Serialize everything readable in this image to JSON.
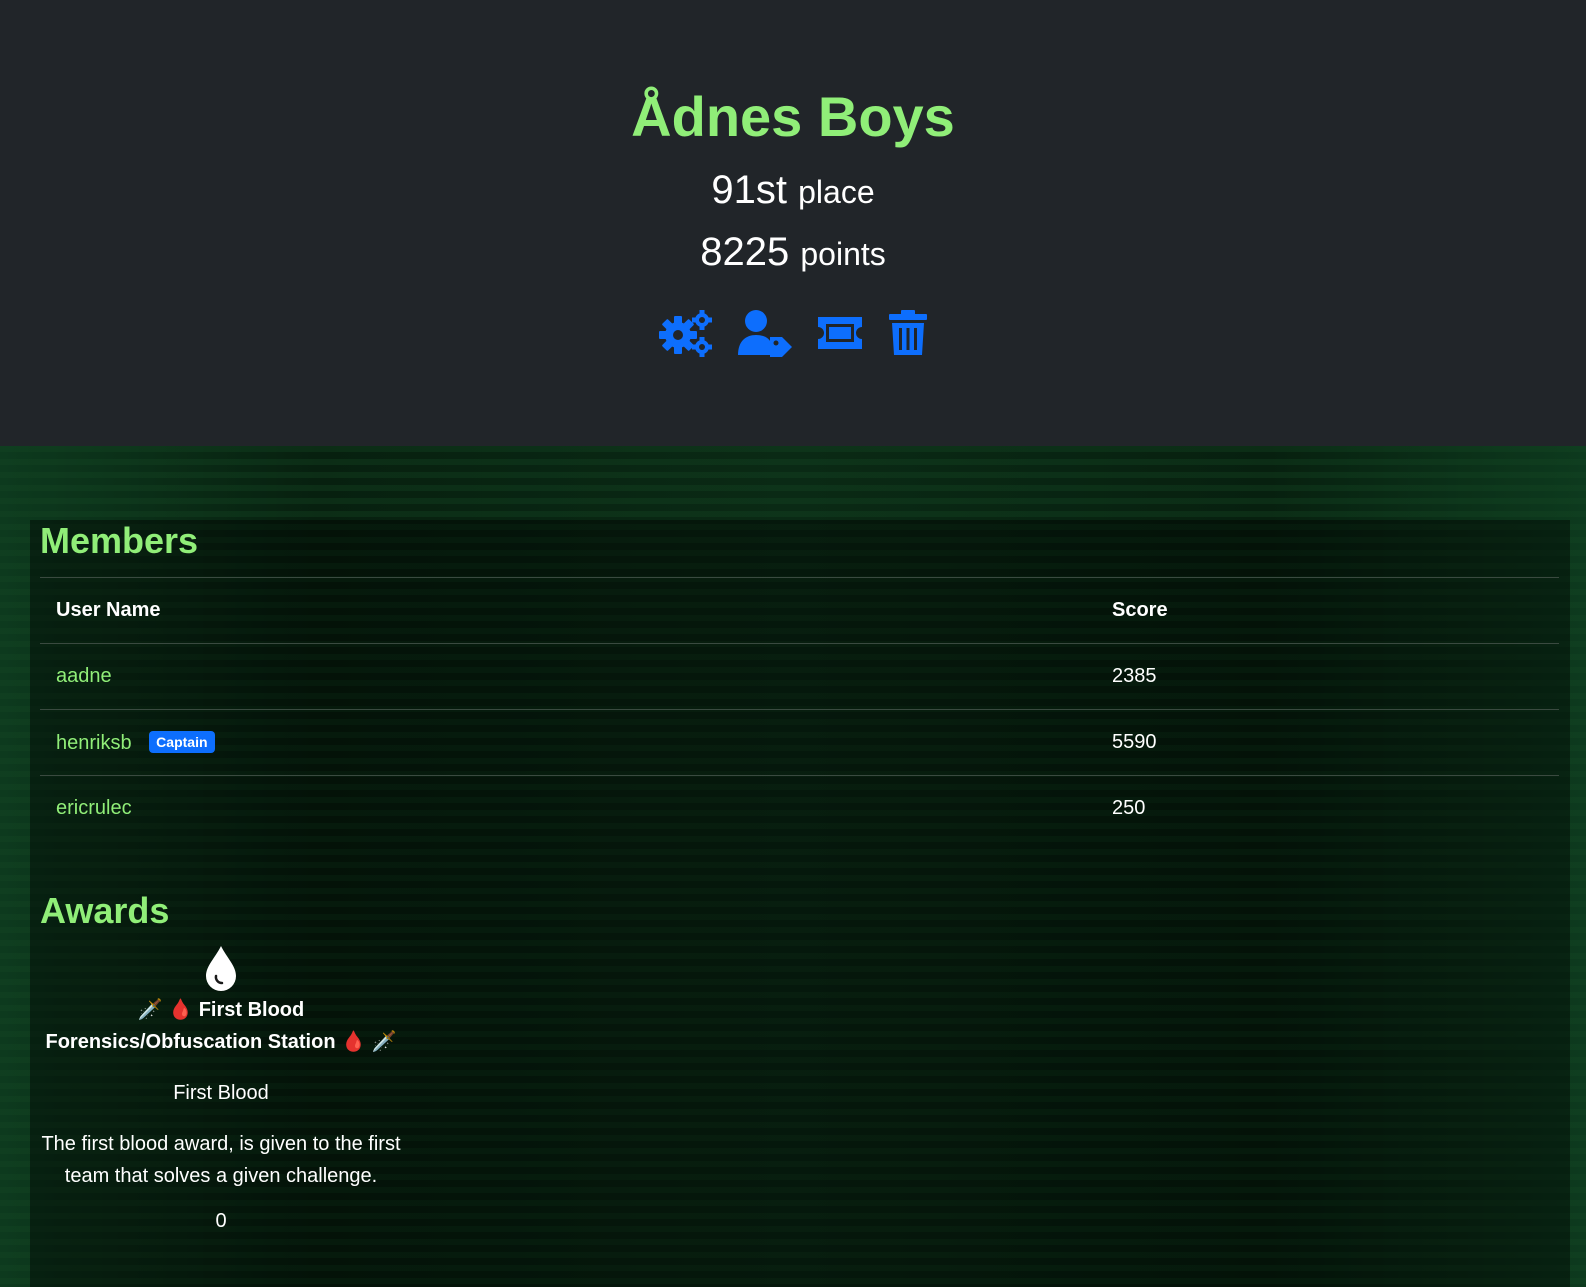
{
  "team": {
    "name": "Ådnes Boys",
    "place_number": "91st",
    "place_suffix": "place",
    "points_number": "8225",
    "points_suffix": "points"
  },
  "actions": [
    {
      "icon": "settings-gears-icon"
    },
    {
      "icon": "user-tag-icon"
    },
    {
      "icon": "ticket-icon"
    },
    {
      "icon": "trash-icon"
    }
  ],
  "colors": {
    "accent_green": "#90ee78",
    "action_blue": "#0d6efd",
    "header_bg": "#212529"
  },
  "members": {
    "title": "Members",
    "headers": {
      "user": "User Name",
      "score": "Score"
    },
    "rows": [
      {
        "user": "aadne",
        "score": "2385",
        "badge": ""
      },
      {
        "user": "henriksb",
        "score": "5590",
        "badge": "Captain"
      },
      {
        "user": "ericrulec",
        "score": "250",
        "badge": ""
      }
    ]
  },
  "awards": {
    "title": "Awards",
    "items": [
      {
        "icon": "droplet-icon",
        "name_line1": "First Blood",
        "name_line2": "Forensics/Obfuscation Station",
        "category": "First Blood",
        "description": "The first blood award, is given to the first team that solves a given challenge.",
        "value": "0"
      }
    ]
  }
}
